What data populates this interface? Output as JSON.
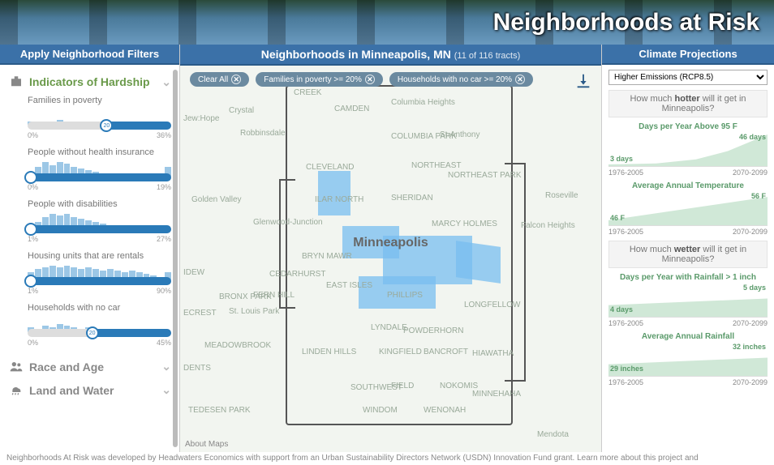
{
  "banner": {
    "title": "Neighborhoods at Risk"
  },
  "left": {
    "header": "Apply Neighborhood Filters",
    "sections": {
      "hardship": {
        "title": "Indicators of Hardship",
        "filters": [
          {
            "label": "Families in poverty",
            "min": "0%",
            "max": "36%",
            "thumb_pct": 55,
            "thumb_text": "20"
          },
          {
            "label": "People without health insurance",
            "min": "0%",
            "max": "19%",
            "thumb_pct": 2,
            "thumb_text": ""
          },
          {
            "label": "People with disabilities",
            "min": "1%",
            "max": "27%",
            "thumb_pct": 2,
            "thumb_text": ""
          },
          {
            "label": "Housing units that are rentals",
            "min": "1%",
            "max": "90%",
            "thumb_pct": 2,
            "thumb_text": ""
          },
          {
            "label": "Households with no car",
            "min": "0%",
            "max": "45%",
            "thumb_pct": 45,
            "thumb_text": "20"
          }
        ]
      },
      "race": {
        "title": "Race and Age"
      },
      "land": {
        "title": "Land and Water"
      }
    }
  },
  "center": {
    "title_prefix": "Neighborhoods in ",
    "city": "Minneapolis, MN",
    "tract_note": "(11 of 116 tracts)",
    "chips": [
      {
        "label": "Clear All"
      },
      {
        "label": "Families in poverty >= 20%"
      },
      {
        "label": "Households with no car >= 20%"
      }
    ],
    "city_label": "Minneapolis",
    "about": "About Maps",
    "bg_labels": [
      "CREEK",
      "Jew:Hope",
      "Crystal",
      "Robbinsdale",
      "CAMDEN",
      "Columbia Heights",
      "COLUMBIA PARK",
      "St-Anthony",
      "CLEVELAND",
      "NORTHEAST",
      "NORTHEAST PARK",
      "Golden Valley",
      "ILAR NORTH",
      "SHERIDAN",
      "Roseville",
      "Glenwood-Junction",
      "MARCY HOLMES",
      "Falcon Heights",
      "BRYN MAWR",
      "CEDARHURST",
      "FERN HILL",
      "BRONX PARK",
      "St. Louis Park",
      "EAST ISLES",
      "PHILLIPS",
      "LONGFELLOW",
      "ECREST",
      "MEADOWBROOK",
      "LINDEN HILLS",
      "LYNDALE",
      "POWDERHORN",
      "KINGFIELD",
      "BANCROFT",
      "HIAWATHA",
      "DENTS",
      "SOUTHWEST",
      "FIELD",
      "NOKOMIS",
      "MINNEHAHA",
      "TEDESEN PARK",
      "WINDOM",
      "WENONAH",
      "Mendota",
      "IDEW"
    ]
  },
  "right": {
    "header": "Climate Projections",
    "scenario": "Higher Emissions (RCP8.5)",
    "q_hot_pre": "How much ",
    "q_hot_b": "hotter",
    "q_hot_post": " will it get in Minneapolis?",
    "q_wet_pre": "How much ",
    "q_wet_b": "wetter",
    "q_wet_post": " will it get in Minneapolis?",
    "xl": "1976-2005",
    "xr": "2070-2099",
    "charts": [
      {
        "title": "Days per Year Above 95 F",
        "left": "3 days",
        "right": "46 days",
        "shape": "exp"
      },
      {
        "title": "Average Annual Temperature",
        "left": "46 F",
        "right": "56 F",
        "shape": "lin"
      },
      {
        "title": "Days per Year with Rainfall > 1 inch",
        "left": "4 days",
        "right": "5 days",
        "shape": "flat"
      },
      {
        "title": "Average Annual Rainfall",
        "left": "29 inches",
        "right": "32 inches",
        "shape": "flat"
      }
    ]
  },
  "footer": "Neighborhoods At Risk was developed by Headwaters Economics with support from an Urban Sustainability Directors Network (USDN) Innovation Fund grant. Learn more about this project and",
  "chart_data": [
    {
      "type": "area",
      "title": "Days per Year Above 95 F",
      "x": [
        "1976-2005",
        "2070-2099"
      ],
      "values": [
        3,
        46
      ],
      "ylabel": "days"
    },
    {
      "type": "area",
      "title": "Average Annual Temperature",
      "x": [
        "1976-2005",
        "2070-2099"
      ],
      "values": [
        46,
        56
      ],
      "ylabel": "°F"
    },
    {
      "type": "area",
      "title": "Days per Year with Rainfall > 1 inch",
      "x": [
        "1976-2005",
        "2070-2099"
      ],
      "values": [
        4,
        5
      ],
      "ylabel": "days"
    },
    {
      "type": "area",
      "title": "Average Annual Rainfall",
      "x": [
        "1976-2005",
        "2070-2099"
      ],
      "values": [
        29,
        32
      ],
      "ylabel": "inches"
    }
  ]
}
